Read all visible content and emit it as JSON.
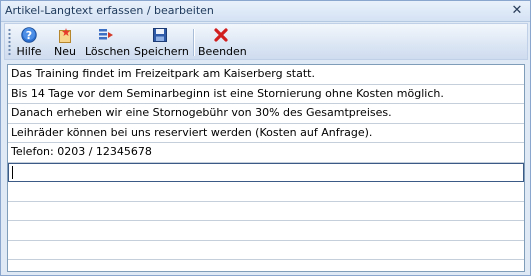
{
  "window": {
    "title": "Artikel-Langtext erfassen / bearbeiten",
    "close_glyph": "✕"
  },
  "toolbar": {
    "buttons": [
      {
        "label": "Hilfe",
        "icon": "help-icon"
      },
      {
        "label": "Neu",
        "icon": "new-icon"
      },
      {
        "label": "Löschen",
        "icon": "delete-rows-icon"
      },
      {
        "label": "Speichern",
        "icon": "save-icon"
      },
      {
        "label": "Beenden",
        "icon": "close-red-x-icon"
      }
    ]
  },
  "grid": {
    "rows": [
      "Das Training findet im Freizeitpark am Kaiserberg statt.",
      "Bis 14 Tage vor dem Seminarbeginn ist eine Stornierung ohne Kosten möglich.",
      "Danach erheben wir eine Stornogebühr von 30% des Gesamtpreises.",
      "Leihräder können bei uns reserviert werden (Kosten auf Anfrage).",
      "Telefon: 0203 / 12345678",
      "",
      "",
      "",
      "",
      "",
      ""
    ]
  },
  "colors": {
    "help_blue": "#2b6fd0",
    "delete_red": "#d23a2a",
    "close_red": "#d11f1f"
  }
}
